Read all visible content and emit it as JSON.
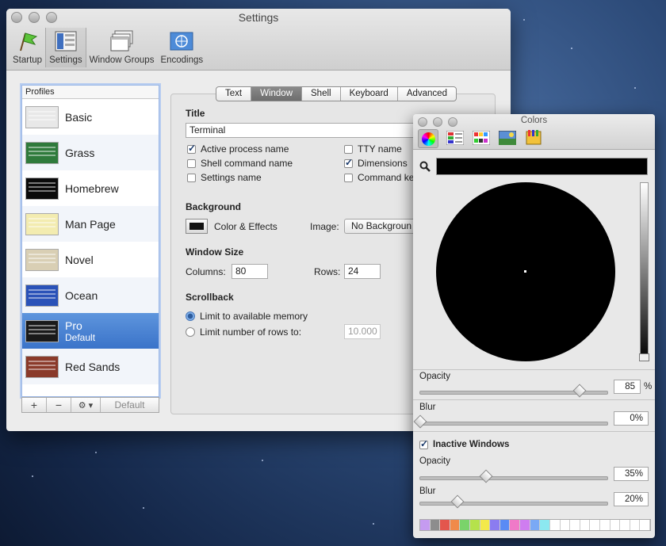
{
  "settings_window": {
    "title": "Settings",
    "toolbar": [
      {
        "label": "Startup",
        "icon": "startup-icon"
      },
      {
        "label": "Settings",
        "icon": "settings-icon"
      },
      {
        "label": "Window Groups",
        "icon": "window-groups-icon"
      },
      {
        "label": "Encodings",
        "icon": "encodings-icon"
      }
    ],
    "profiles_header": "Profiles",
    "profiles": [
      {
        "name": "Basic",
        "sub": "",
        "color": "#e8e8e8"
      },
      {
        "name": "Grass",
        "sub": "",
        "color": "#2f7a3b"
      },
      {
        "name": "Homebrew",
        "sub": "",
        "color": "#0b0b0b"
      },
      {
        "name": "Man Page",
        "sub": "",
        "color": "#f3ecb0"
      },
      {
        "name": "Novel",
        "sub": "",
        "color": "#d9cfb4"
      },
      {
        "name": "Ocean",
        "sub": "",
        "color": "#2a52b8"
      },
      {
        "name": "Pro",
        "sub": "Default",
        "color": "#1a1a1a"
      },
      {
        "name": "Red Sands",
        "sub": "",
        "color": "#8a3a2a"
      }
    ],
    "profile_buttons": {
      "add": "+",
      "remove": "−",
      "gear": "⚙ ▾",
      "default": "Default"
    },
    "tabs": [
      "Text",
      "Window",
      "Shell",
      "Keyboard",
      "Advanced"
    ],
    "active_tab": "Window",
    "title_section": {
      "heading": "Title",
      "value": "Terminal",
      "checkboxes": [
        {
          "label": "Active process name",
          "checked": true
        },
        {
          "label": "Shell command name",
          "checked": false
        },
        {
          "label": "Settings name",
          "checked": false
        },
        {
          "label": "TTY name",
          "checked": false
        },
        {
          "label": "Dimensions",
          "checked": true
        },
        {
          "label": "Command ke",
          "checked": false
        }
      ]
    },
    "background": {
      "heading": "Background",
      "color_label": "Color & Effects",
      "image_label": "Image:",
      "image_value": "No Backgroun"
    },
    "window_size": {
      "heading": "Window Size",
      "columns_label": "Columns:",
      "columns": "80",
      "rows_label": "Rows:",
      "rows": "24"
    },
    "scrollback": {
      "heading": "Scrollback",
      "opt1": "Limit to available memory",
      "opt2": "Limit number of rows to:",
      "rows_placeholder": "10.000"
    }
  },
  "colors_window": {
    "title": "Colors",
    "opacity": {
      "label": "Opacity",
      "value": "85",
      "unit": "%",
      "fraction": 0.85
    },
    "blur": {
      "label": "Blur",
      "value": "0%",
      "fraction": 0
    },
    "inactive": {
      "label": "Inactive Windows",
      "checked": true
    },
    "inactive_opacity": {
      "label": "Opacity",
      "value": "35%",
      "fraction": 0.35
    },
    "inactive_blur": {
      "label": "Blur",
      "value": "20%",
      "fraction": 0.2
    },
    "swatches": [
      "#c59bf0",
      "#8d8d8d",
      "#e3564d",
      "#f08a4a",
      "#7ad36a",
      "#b5e24b",
      "#f3e94a",
      "#8b7cf0",
      "#5a8bf5",
      "#f07ac8",
      "#cf7df0",
      "#7aa9f5",
      "#8ce8f0",
      "#ffffff",
      "#ffffff",
      "#ffffff",
      "#ffffff",
      "#ffffff",
      "#ffffff",
      "#ffffff",
      "#ffffff",
      "#ffffff",
      "#ffffff"
    ]
  }
}
